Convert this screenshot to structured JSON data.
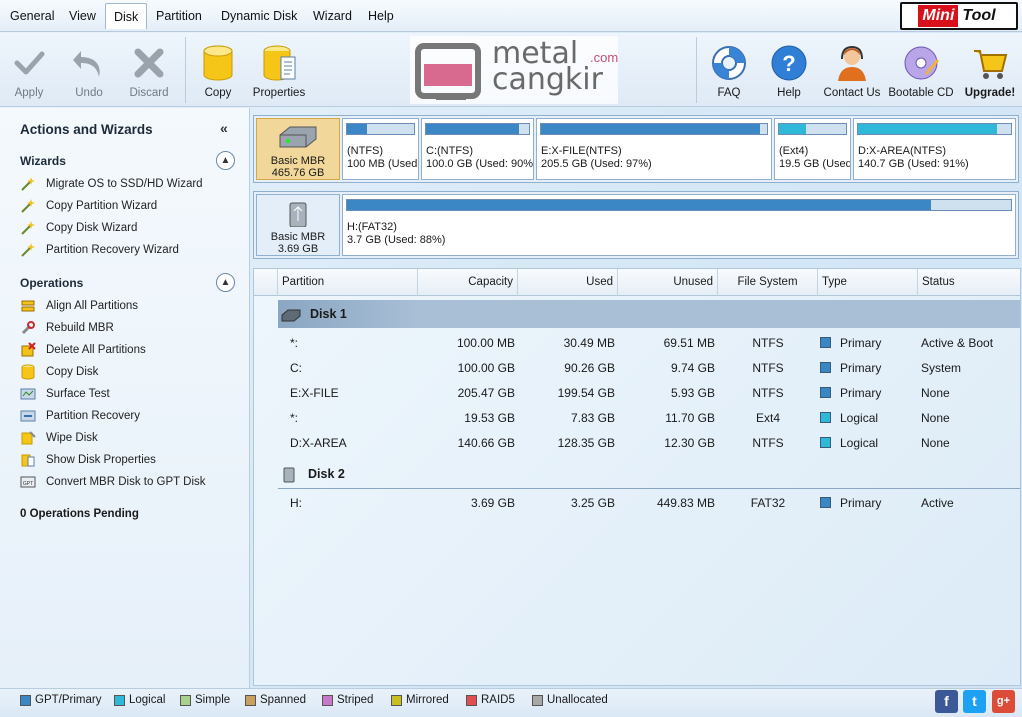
{
  "menu": {
    "items": [
      {
        "label": "General",
        "active": false
      },
      {
        "label": "View",
        "active": false
      },
      {
        "label": "Disk",
        "active": true
      },
      {
        "label": "Partition",
        "active": false
      },
      {
        "label": "Dynamic Disk",
        "active": false
      },
      {
        "label": "Wizard",
        "active": false
      },
      {
        "label": "Help",
        "active": false
      }
    ],
    "logo_mini": "Mini",
    "logo_tool": "Tool"
  },
  "toolbar": {
    "apply": "Apply",
    "undo": "Undo",
    "discard": "Discard",
    "copy": "Copy",
    "properties": "Properties",
    "faq": "FAQ",
    "help": "Help",
    "contact": "Contact Us",
    "bootable": "Bootable CD",
    "upgrade": "Upgrade!"
  },
  "watermark": {
    "line1": "metal",
    "line2": "cangkir",
    "suffix": ".com"
  },
  "left_panel": {
    "title": "Actions and Wizards",
    "collapse_glyph": "«",
    "wizards_heading": "Wizards",
    "wizards": [
      "Migrate OS to SSD/HD Wizard",
      "Copy Partition Wizard",
      "Copy Disk Wizard",
      "Partition Recovery Wizard"
    ],
    "operations_heading": "Operations",
    "operations": [
      "Align All Partitions",
      "Rebuild MBR",
      "Delete All Partitions",
      "Copy Disk",
      "Surface Test",
      "Partition Recovery",
      "Wipe Disk",
      "Show Disk Properties",
      "Convert MBR Disk to GPT Disk"
    ],
    "pending": "0 Operations Pending"
  },
  "disk_map": {
    "disk1": {
      "type": "Basic MBR",
      "size": "465.76 GB",
      "partitions": [
        {
          "name": "(NTFS)",
          "detail": "100 MB (Used:",
          "used_fraction": 0.3,
          "color": "#3b86c4"
        },
        {
          "name": "C:(NTFS)",
          "detail": "100.0 GB (Used: 90%",
          "used_fraction": 0.9,
          "color": "#3b86c4"
        },
        {
          "name": "E:X-FILE(NTFS)",
          "detail": "205.5 GB (Used: 97%)",
          "used_fraction": 0.97,
          "color": "#3b86c4"
        },
        {
          "name": "(Ext4)",
          "detail": "19.5 GB (Used",
          "used_fraction": 0.4,
          "color": "#2fb8d8"
        },
        {
          "name": "D:X-AREA(NTFS)",
          "detail": "140.7 GB (Used: 91%)",
          "used_fraction": 0.91,
          "color": "#2fb8d8"
        }
      ]
    },
    "disk2": {
      "type": "Basic MBR",
      "size": "3.69 GB",
      "partitions": [
        {
          "name": "H:(FAT32)",
          "detail": "3.7 GB (Used: 88%)",
          "used_fraction": 0.88,
          "color": "#3b86c4"
        }
      ]
    }
  },
  "table": {
    "headers": [
      "Partition",
      "Capacity",
      "Used",
      "Unused",
      "File System",
      "Type",
      "Status"
    ],
    "disk1_label": "Disk 1",
    "disk2_label": "Disk 2",
    "disk1_rows": [
      {
        "partition": "*:",
        "capacity": "100.00 MB",
        "used": "30.49 MB",
        "unused": "69.51 MB",
        "fs": "NTFS",
        "type": "Primary",
        "type_color": "#3b86c4",
        "status": "Active & Boot"
      },
      {
        "partition": "C:",
        "capacity": "100.00 GB",
        "used": "90.26 GB",
        "unused": "9.74 GB",
        "fs": "NTFS",
        "type": "Primary",
        "type_color": "#3b86c4",
        "status": "System"
      },
      {
        "partition": "E:X-FILE",
        "capacity": "205.47 GB",
        "used": "199.54 GB",
        "unused": "5.93 GB",
        "fs": "NTFS",
        "type": "Primary",
        "type_color": "#3b86c4",
        "status": "None"
      },
      {
        "partition": "*:",
        "capacity": "19.53 GB",
        "used": "7.83 GB",
        "unused": "11.70 GB",
        "fs": "Ext4",
        "type": "Logical",
        "type_color": "#2fb8d8",
        "status": "None"
      },
      {
        "partition": "D:X-AREA",
        "capacity": "140.66 GB",
        "used": "128.35 GB",
        "unused": "12.30 GB",
        "fs": "NTFS",
        "type": "Logical",
        "type_color": "#2fb8d8",
        "status": "None"
      }
    ],
    "disk2_rows": [
      {
        "partition": "H:",
        "capacity": "3.69 GB",
        "used": "3.25 GB",
        "unused": "449.83 MB",
        "fs": "FAT32",
        "type": "Primary",
        "type_color": "#3b86c4",
        "status": "Active"
      }
    ]
  },
  "legend": [
    {
      "label": "GPT/Primary",
      "color": "#3b86c4"
    },
    {
      "label": "Logical",
      "color": "#2fb8d8"
    },
    {
      "label": "Simple",
      "color": "#a9d18e"
    },
    {
      "label": "Spanned",
      "color": "#c8a060"
    },
    {
      "label": "Striped",
      "color": "#c878c8"
    },
    {
      "label": "Mirrored",
      "color": "#c8c020"
    },
    {
      "label": "RAID5",
      "color": "#e05050"
    },
    {
      "label": "Unallocated",
      "color": "#a8a8a8"
    }
  ],
  "social": {
    "facebook": "f",
    "twitter": "t",
    "google": "g+"
  }
}
